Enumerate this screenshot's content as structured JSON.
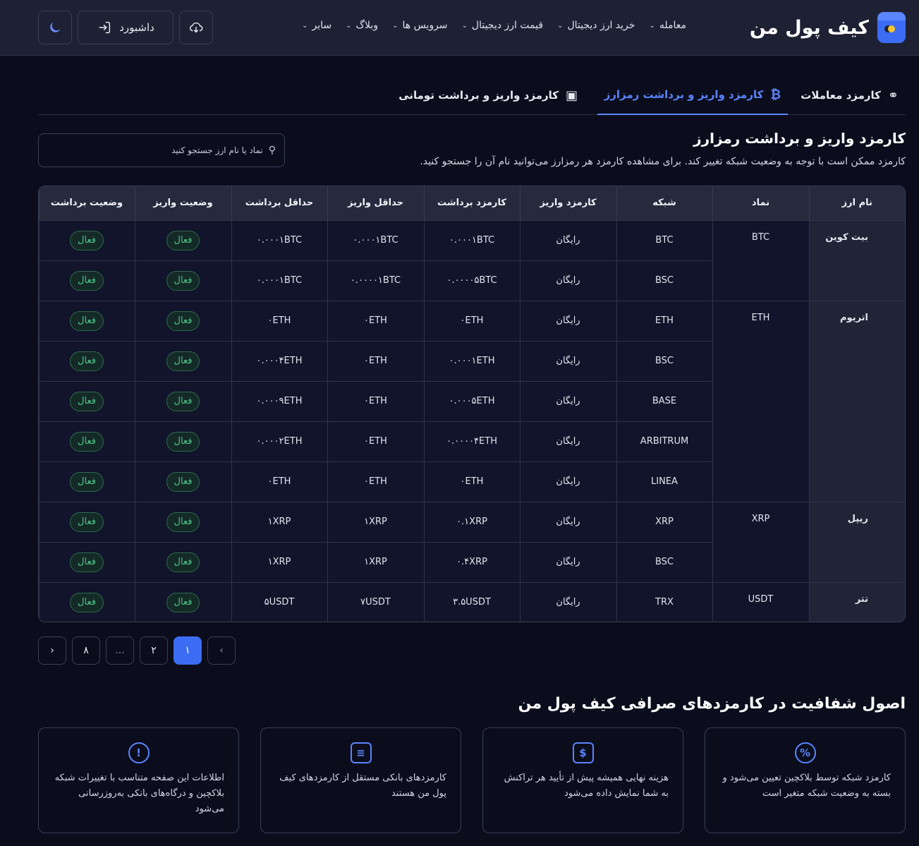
{
  "brand": {
    "name": "کیف پول من",
    "color": "#3d6cf4"
  },
  "nav": [
    {
      "label": "معامله"
    },
    {
      "label": "خرید ارز دیجیتال"
    },
    {
      "label": "قیمت ارز دیجیتال"
    },
    {
      "label": "سرویس ها"
    },
    {
      "label": "وبلاگ"
    },
    {
      "label": "سایر"
    }
  ],
  "header_buttons": {
    "dashboard": "داشبورد"
  },
  "tabs": [
    {
      "label": "کارمزد معاملات",
      "icon": "coins-icon"
    },
    {
      "label": "کارمزد واریز و برداشت رمزارز",
      "icon": "bitcoin-icon",
      "active": true
    },
    {
      "label": "کارمزد واریز و برداشت تومانی",
      "icon": "cash-icon"
    }
  ],
  "section": {
    "title": "کارمزد واریز و برداشت رمزارز",
    "description": "کارمزد ممکن است با توجه به وضعیت شبکه تغییر کند. برای مشاهده کارمزد هر رمزارز می‌توانید نام آن را جستجو کنید.",
    "search_placeholder": "نماد یا نام ارز جستجو کنید"
  },
  "table": {
    "headers": [
      "نام ارز",
      "نماد",
      "شبکه",
      "کارمزد واریز",
      "کارمزد برداشت",
      "حداقل واریز",
      "حداقل برداشت",
      "وضعیت واریز",
      "وضعیت برداشت"
    ],
    "groups": [
      {
        "name": "بیت کوین",
        "symbol": "BTC",
        "rows": [
          {
            "network": "BTC",
            "deposit_fee": "رایگان",
            "withdraw_fee": "۰.۰۰۰۱BTC",
            "min_deposit": "۰.۰۰۰۱BTC",
            "min_withdraw": "۰.۰۰۰۱BTC",
            "deposit_status": "فعال",
            "withdraw_status": "فعال"
          },
          {
            "network": "BSC",
            "deposit_fee": "رایگان",
            "withdraw_fee": "۰.۰۰۰۰۵BTC",
            "min_deposit": "۰.۰۰۰۰۱BTC",
            "min_withdraw": "۰.۰۰۰۱BTC",
            "deposit_status": "فعال",
            "withdraw_status": "فعال"
          }
        ]
      },
      {
        "name": "اتریوم",
        "symbol": "ETH",
        "rows": [
          {
            "network": "ETH",
            "deposit_fee": "رایگان",
            "withdraw_fee": "۰ETH",
            "min_deposit": "۰ETH",
            "min_withdraw": "۰ETH",
            "deposit_status": "فعال",
            "withdraw_status": "فعال"
          },
          {
            "network": "BSC",
            "deposit_fee": "رایگان",
            "withdraw_fee": "۰.۰۰۰۱ETH",
            "min_deposit": "۰ETH",
            "min_withdraw": "۰.۰۰۰۴ETH",
            "deposit_status": "فعال",
            "withdraw_status": "فعال"
          },
          {
            "network": "BASE",
            "deposit_fee": "رایگان",
            "withdraw_fee": "۰.۰۰۰۵ETH",
            "min_deposit": "۰ETH",
            "min_withdraw": "۰.۰۰۰۹ETH",
            "deposit_status": "فعال",
            "withdraw_status": "فعال"
          },
          {
            "network": "ARBITRUM",
            "deposit_fee": "رایگان",
            "withdraw_fee": "۰.۰۰۰۰۴ETH",
            "min_deposit": "۰ETH",
            "min_withdraw": "۰.۰۰۰۲ETH",
            "deposit_status": "فعال",
            "withdraw_status": "فعال"
          },
          {
            "network": "LINEA",
            "deposit_fee": "رایگان",
            "withdraw_fee": "۰ETH",
            "min_deposit": "۰ETH",
            "min_withdraw": "۰ETH",
            "deposit_status": "فعال",
            "withdraw_status": "فعال"
          }
        ]
      },
      {
        "name": "ریپل",
        "symbol": "XRP",
        "rows": [
          {
            "network": "XRP",
            "deposit_fee": "رایگان",
            "withdraw_fee": "۰.۱XRP",
            "min_deposit": "۱XRP",
            "min_withdraw": "۱XRP",
            "deposit_status": "فعال",
            "withdraw_status": "فعال"
          },
          {
            "network": "BSC",
            "deposit_fee": "رایگان",
            "withdraw_fee": "۰.۴XRP",
            "min_deposit": "۱XRP",
            "min_withdraw": "۱XRP",
            "deposit_status": "فعال",
            "withdraw_status": "فعال"
          }
        ]
      },
      {
        "name": "تتر",
        "symbol": "USDT",
        "rows": [
          {
            "network": "TRX",
            "deposit_fee": "رایگان",
            "withdraw_fee": "۳.۵USDT",
            "min_deposit": "۷USDT",
            "min_withdraw": "۵USDT",
            "deposit_status": "فعال",
            "withdraw_status": "فعال"
          }
        ]
      }
    ]
  },
  "pagination": {
    "pages": [
      "۱",
      "۲",
      "...",
      "۸"
    ],
    "current": "۱"
  },
  "transparency": {
    "title": "اصول شفافیت در کارمزدهای صرافی کیف پول من",
    "cards": [
      {
        "icon": "percent-icon",
        "text": "کارمزد شبکه توسط بلاکچین تعیین می‌شود و بسته به وضعیت شبکه متغیر است"
      },
      {
        "icon": "dollar-icon",
        "text": "هزینه نهایی همیشه پیش از تأیید هر تراکنش به شما نمایش داده می‌شود"
      },
      {
        "icon": "receipt-icon",
        "text": "کارمزدهای بانکی مستقل از کارمزدهای کیف پول من هستند"
      },
      {
        "icon": "info-icon",
        "text": "اطلاعات این صفحه متناسب با تغییرات شبکه بلاکچین و درگاه‌های بانکی به‌روزرسانی می‌شود"
      }
    ]
  }
}
